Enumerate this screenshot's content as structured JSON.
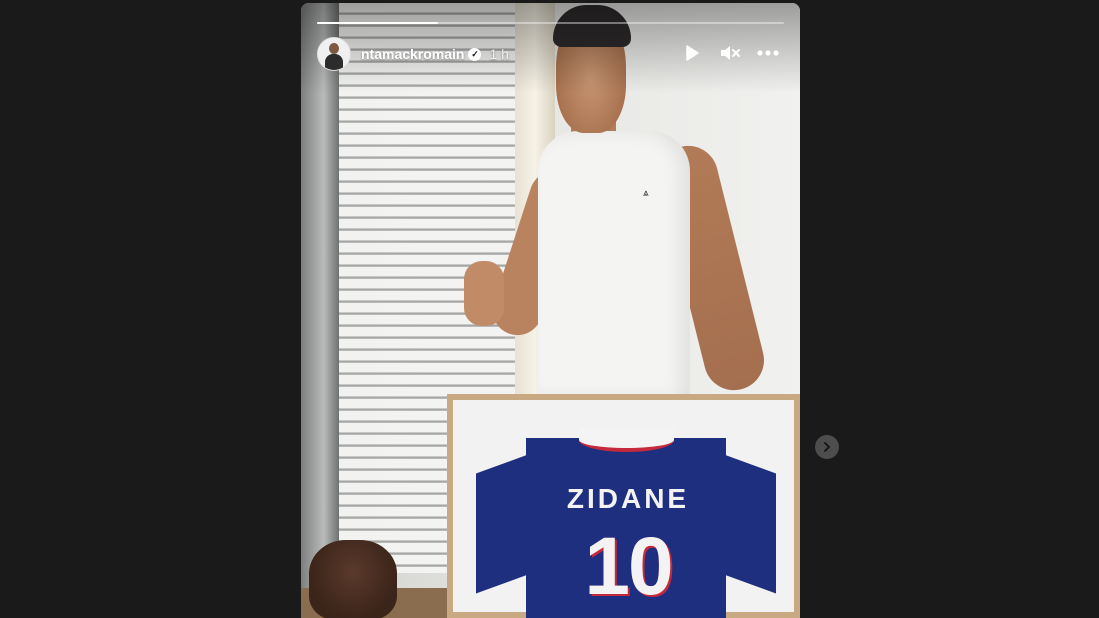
{
  "story": {
    "username": "ntamackromain",
    "time": "1 h",
    "progress": 0.26,
    "verified": true
  },
  "photo": {
    "jersey_name": "ZIDANE",
    "jersey_number": "10"
  },
  "icons": {
    "play": "play-icon",
    "mute": "muted-speaker-icon",
    "more": "more-options-icon",
    "next": "chevron-right-icon",
    "verified": "verified-badge-icon"
  },
  "colors": {
    "background": "#1a1a1a",
    "jersey_blue": "#1f2f7f",
    "jersey_red": "#c42a3b"
  }
}
